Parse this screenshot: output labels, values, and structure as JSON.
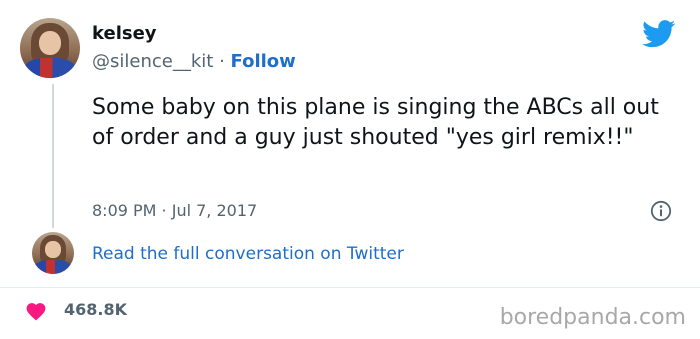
{
  "user": {
    "display_name": "kelsey",
    "handle": "@silence__kit",
    "separator": "·",
    "follow_label": "Follow"
  },
  "tweet": {
    "text": "Some baby on this plane is singing the ABCs all out of order and a guy just shouted \"yes girl remix!!\"",
    "timestamp": "8:09 PM · Jul 7, 2017"
  },
  "conversation": {
    "link_label": "Read the full conversation on Twitter"
  },
  "engagement": {
    "likes": "468.8K"
  },
  "watermark": "boredpanda.com",
  "icons": {
    "brand": "twitter-bird-icon",
    "info": "info-icon",
    "like": "heart-icon"
  },
  "colors": {
    "twitter_blue": "#1d9bf0",
    "link_blue": "#1d6fc9",
    "heart_pink": "#f91880",
    "muted_text": "#536471"
  }
}
